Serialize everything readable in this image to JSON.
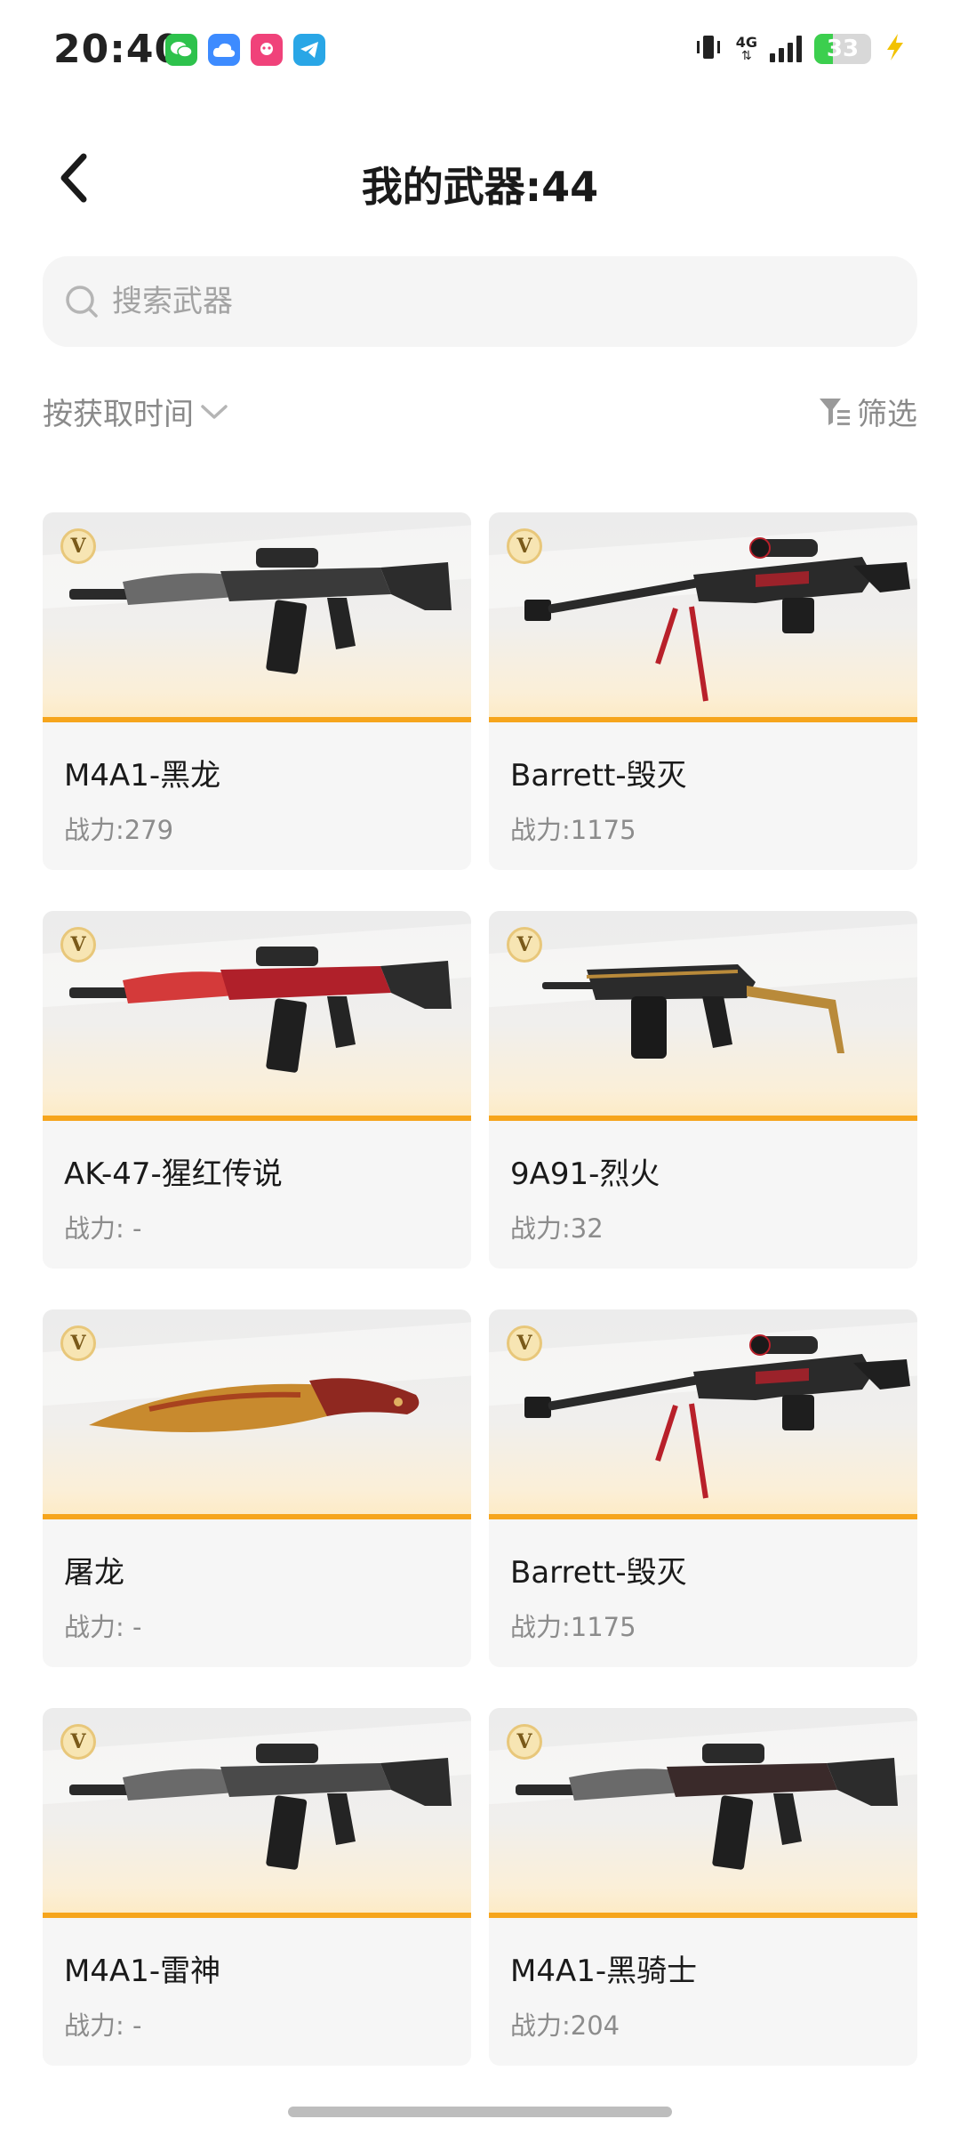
{
  "status_bar": {
    "time": "20:40",
    "network": "4G",
    "battery_level": "33",
    "battery_fraction": 0.33,
    "apps": [
      "wechat-icon",
      "cloud-drive-icon",
      "game-app-icon",
      "telegram-icon"
    ]
  },
  "header": {
    "title": "我的武器:44"
  },
  "search": {
    "placeholder": "搜索武器"
  },
  "sort": {
    "label": "按获取时间"
  },
  "filter": {
    "label": "筛选"
  },
  "colors": {
    "accent": "#f6a51c",
    "card_bg": "#f6f6f6",
    "muted_text": "#8c8c8c",
    "badge_gold": "#e8c77a"
  },
  "weapons": [
    {
      "name": "M4A1-黑龙",
      "power": "战力:279",
      "badge": "V",
      "icon": "rifle-icon",
      "palette": "#3a3a3a"
    },
    {
      "name": "Barrett-毁灭",
      "power": "战力:1175",
      "badge": "V",
      "icon": "sniper-rifle-icon",
      "palette": "#2a2a2a"
    },
    {
      "name": "AK-47-猩红传说",
      "power": "战力: -",
      "badge": "V",
      "icon": "rifle-icon",
      "palette": "#b0202a"
    },
    {
      "name": "9A91-烈火",
      "power": "战力:32",
      "badge": "V",
      "icon": "smg-icon",
      "palette": "#2b2b2b"
    },
    {
      "name": "屠龙",
      "power": "战力: -",
      "badge": "V",
      "icon": "knife-icon",
      "palette": "#c0792a"
    },
    {
      "name": "Barrett-毁灭",
      "power": "战力:1175",
      "badge": "V",
      "icon": "sniper-rifle-icon",
      "palette": "#2a2a2a"
    },
    {
      "name": "M4A1-雷神",
      "power": "战力: -",
      "badge": "V",
      "icon": "rifle-icon",
      "palette": "#4a4a4a"
    },
    {
      "name": "M4A1-黑骑士",
      "power": "战力:204",
      "badge": "V",
      "icon": "rifle-icon",
      "palette": "#3a2a2a"
    }
  ]
}
